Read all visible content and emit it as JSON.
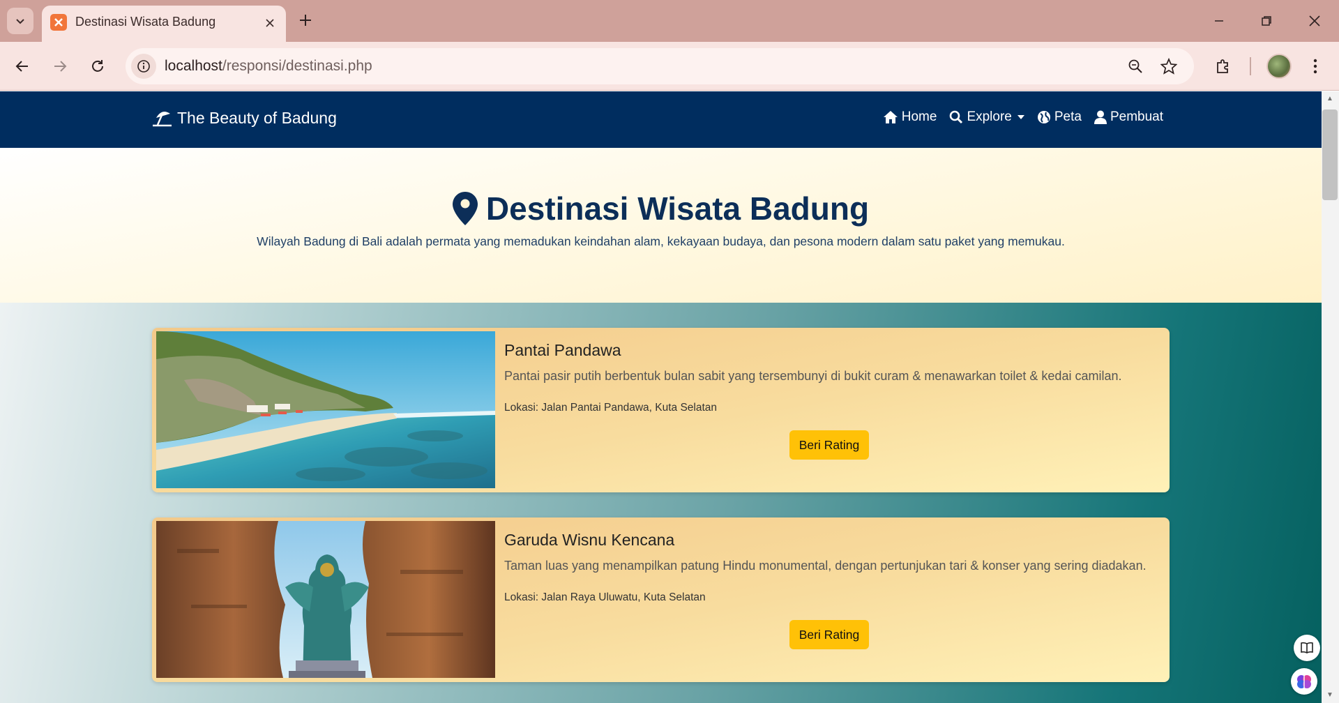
{
  "browser": {
    "tab_title": "Destinasi Wisata Badung",
    "url_host": "localhost",
    "url_path": "/responsi/destinasi.php"
  },
  "site": {
    "brand": "The Beauty of Badung",
    "nav": [
      {
        "label": "Home",
        "icon": "home-icon"
      },
      {
        "label": "Explore",
        "icon": "search-icon"
      },
      {
        "label": "Peta",
        "icon": "globe-icon"
      },
      {
        "label": "Pembuat",
        "icon": "user-icon"
      }
    ]
  },
  "hero": {
    "title": "Destinasi Wisata Badung",
    "subtitle": "Wilayah Badung di Bali adalah permata yang memadukan keindahan alam, kekayaan budaya, dan pesona modern dalam satu paket yang memukau."
  },
  "destinations": [
    {
      "name": "Pantai Pandawa",
      "description": "Pantai pasir putih berbentuk bulan sabit yang tersembunyi di bukit curam & menawarkan toilet & kedai camilan.",
      "location": "Lokasi: Jalan Pantai Pandawa, Kuta Selatan",
      "button": "Beri Rating"
    },
    {
      "name": "Garuda Wisnu Kencana",
      "description": "Taman luas yang menampilkan patung Hindu monumental, dengan pertunjukan tari & konser yang sering diadakan.",
      "location": "Lokasi: Jalan Raya Uluwatu, Kuta Selatan",
      "button": "Beri Rating"
    }
  ],
  "colors": {
    "browser_frame": "#cfa19a",
    "navbar": "#002d5f",
    "title": "#0c2e58",
    "button": "#ffc107",
    "card": "#f8dc9e"
  }
}
